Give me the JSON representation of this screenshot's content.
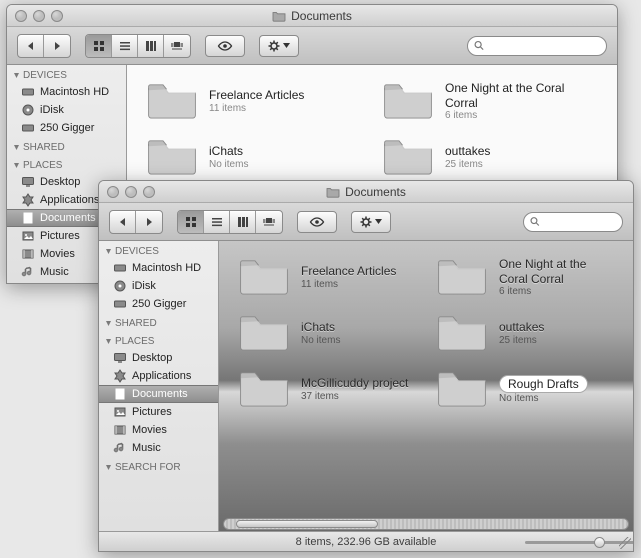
{
  "windows": [
    {
      "title": "Documents",
      "sidebar": {
        "sections": [
          {
            "label": "DEVICES",
            "items": [
              {
                "label": "Macintosh HD",
                "icon": "hd-icon"
              },
              {
                "label": "iDisk",
                "icon": "idisk-icon"
              },
              {
                "label": "250 Gigger",
                "icon": "hd-icon"
              }
            ]
          },
          {
            "label": "SHARED",
            "items": []
          },
          {
            "label": "PLACES",
            "items": [
              {
                "label": "Desktop",
                "icon": "desktop-icon"
              },
              {
                "label": "Applications",
                "icon": "apps-icon"
              },
              {
                "label": "Documents",
                "icon": "docfolder-icon",
                "selected": true
              },
              {
                "label": "Pictures",
                "icon": "pictures-icon"
              },
              {
                "label": "Movies",
                "icon": "movies-icon"
              },
              {
                "label": "Music",
                "icon": "music-icon"
              }
            ]
          }
        ]
      },
      "folders": [
        {
          "name": "Freelance Articles",
          "sub": "11 items"
        },
        {
          "name": "One Night at the Coral Corral",
          "sub": "6 items"
        },
        {
          "name": "iChats",
          "sub": "No items"
        },
        {
          "name": "outtakes",
          "sub": "25 items"
        }
      ]
    },
    {
      "title": "Documents",
      "sidebar": {
        "sections": [
          {
            "label": "DEVICES",
            "items": [
              {
                "label": "Macintosh HD",
                "icon": "hd-icon"
              },
              {
                "label": "iDisk",
                "icon": "idisk-icon"
              },
              {
                "label": "250 Gigger",
                "icon": "hd-icon"
              }
            ]
          },
          {
            "label": "SHARED",
            "items": []
          },
          {
            "label": "PLACES",
            "items": [
              {
                "label": "Desktop",
                "icon": "desktop-icon"
              },
              {
                "label": "Applications",
                "icon": "apps-icon"
              },
              {
                "label": "Documents",
                "icon": "docfolder-icon",
                "selected": true
              },
              {
                "label": "Pictures",
                "icon": "pictures-icon"
              },
              {
                "label": "Movies",
                "icon": "movies-icon"
              },
              {
                "label": "Music",
                "icon": "music-icon"
              }
            ]
          },
          {
            "label": "SEARCH FOR",
            "items": []
          }
        ]
      },
      "folders": [
        {
          "name": "Freelance Articles",
          "sub": "11 items"
        },
        {
          "name": "One Night at the Coral Corral",
          "sub": "6 items"
        },
        {
          "name": "iChats",
          "sub": "No items"
        },
        {
          "name": "outtakes",
          "sub": "25 items"
        },
        {
          "name": "McGillicuddy project",
          "sub": "37 items"
        },
        {
          "name": "Rough Drafts",
          "sub": "No items",
          "editing": true
        }
      ],
      "status": "8 items, 232.96 GB available"
    }
  ],
  "search_placeholder": ""
}
